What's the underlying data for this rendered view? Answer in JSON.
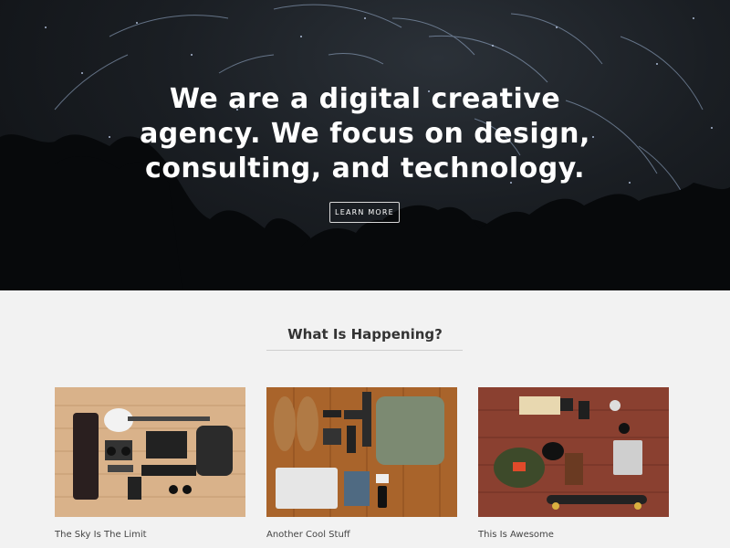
{
  "hero": {
    "headline_lines": [
      "We are a digital creative",
      "agency. We focus on design,",
      "consulting, and technology."
    ],
    "button_label": "LEARN MORE"
  },
  "section": {
    "title": "What Is Happening?"
  },
  "cards": [
    {
      "caption": "The Sky Is The Limit"
    },
    {
      "caption": "Another Cool Stuff"
    },
    {
      "caption": "This Is Awesome"
    }
  ],
  "colors": {
    "hero_bg": "#14181c",
    "page_bg": "#f2f2f2",
    "heading_text": "#333333"
  }
}
